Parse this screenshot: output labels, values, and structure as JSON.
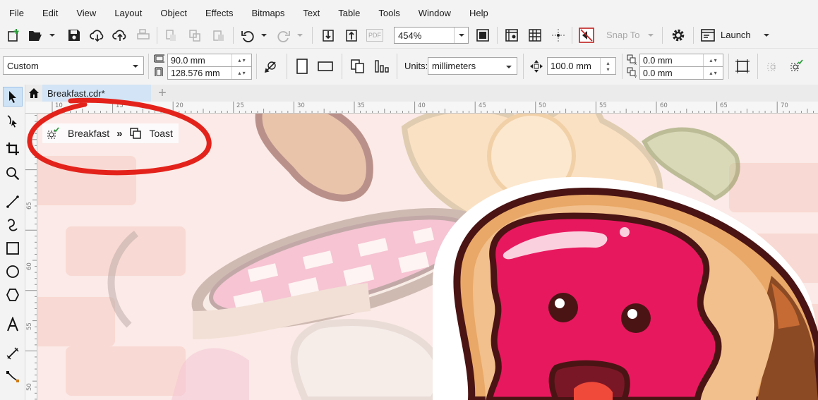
{
  "menu": [
    "File",
    "Edit",
    "View",
    "Layout",
    "Object",
    "Effects",
    "Bitmaps",
    "Text",
    "Table",
    "Tools",
    "Window",
    "Help"
  ],
  "standard_toolbar": {
    "zoom_level": "454%",
    "snap_to_label": "Snap To",
    "launch_label": "Launch",
    "pdf_label": "PDF"
  },
  "property_bar": {
    "page_preset": "Custom",
    "width": "90.0 mm",
    "height": "128.576 mm",
    "units_label": "Units:",
    "units_value": "millimeters",
    "nudge_distance": "100.0 mm",
    "duplicate_x": "0.0 mm",
    "duplicate_y": "0.0 mm"
  },
  "tabs": {
    "document_tab": "Breakfast.cdr*",
    "add_tab": "+"
  },
  "ruler": {
    "h_labels": [
      "10",
      "15",
      "20",
      "25",
      "30",
      "35",
      "40",
      "45",
      "50",
      "55",
      "60",
      "65",
      "70"
    ],
    "v_labels": [
      "65",
      "60",
      "55",
      "50"
    ]
  },
  "breadcrumb": {
    "items": [
      "Breakfast",
      "Toast"
    ],
    "separator": "»"
  },
  "colors": {
    "annotation_red": "#e3231b",
    "jam_pink": "#e8185f",
    "bread_crust": "#e9a867",
    "outline_dark": "#4a1414",
    "tab_active": "#d2e4f5"
  }
}
